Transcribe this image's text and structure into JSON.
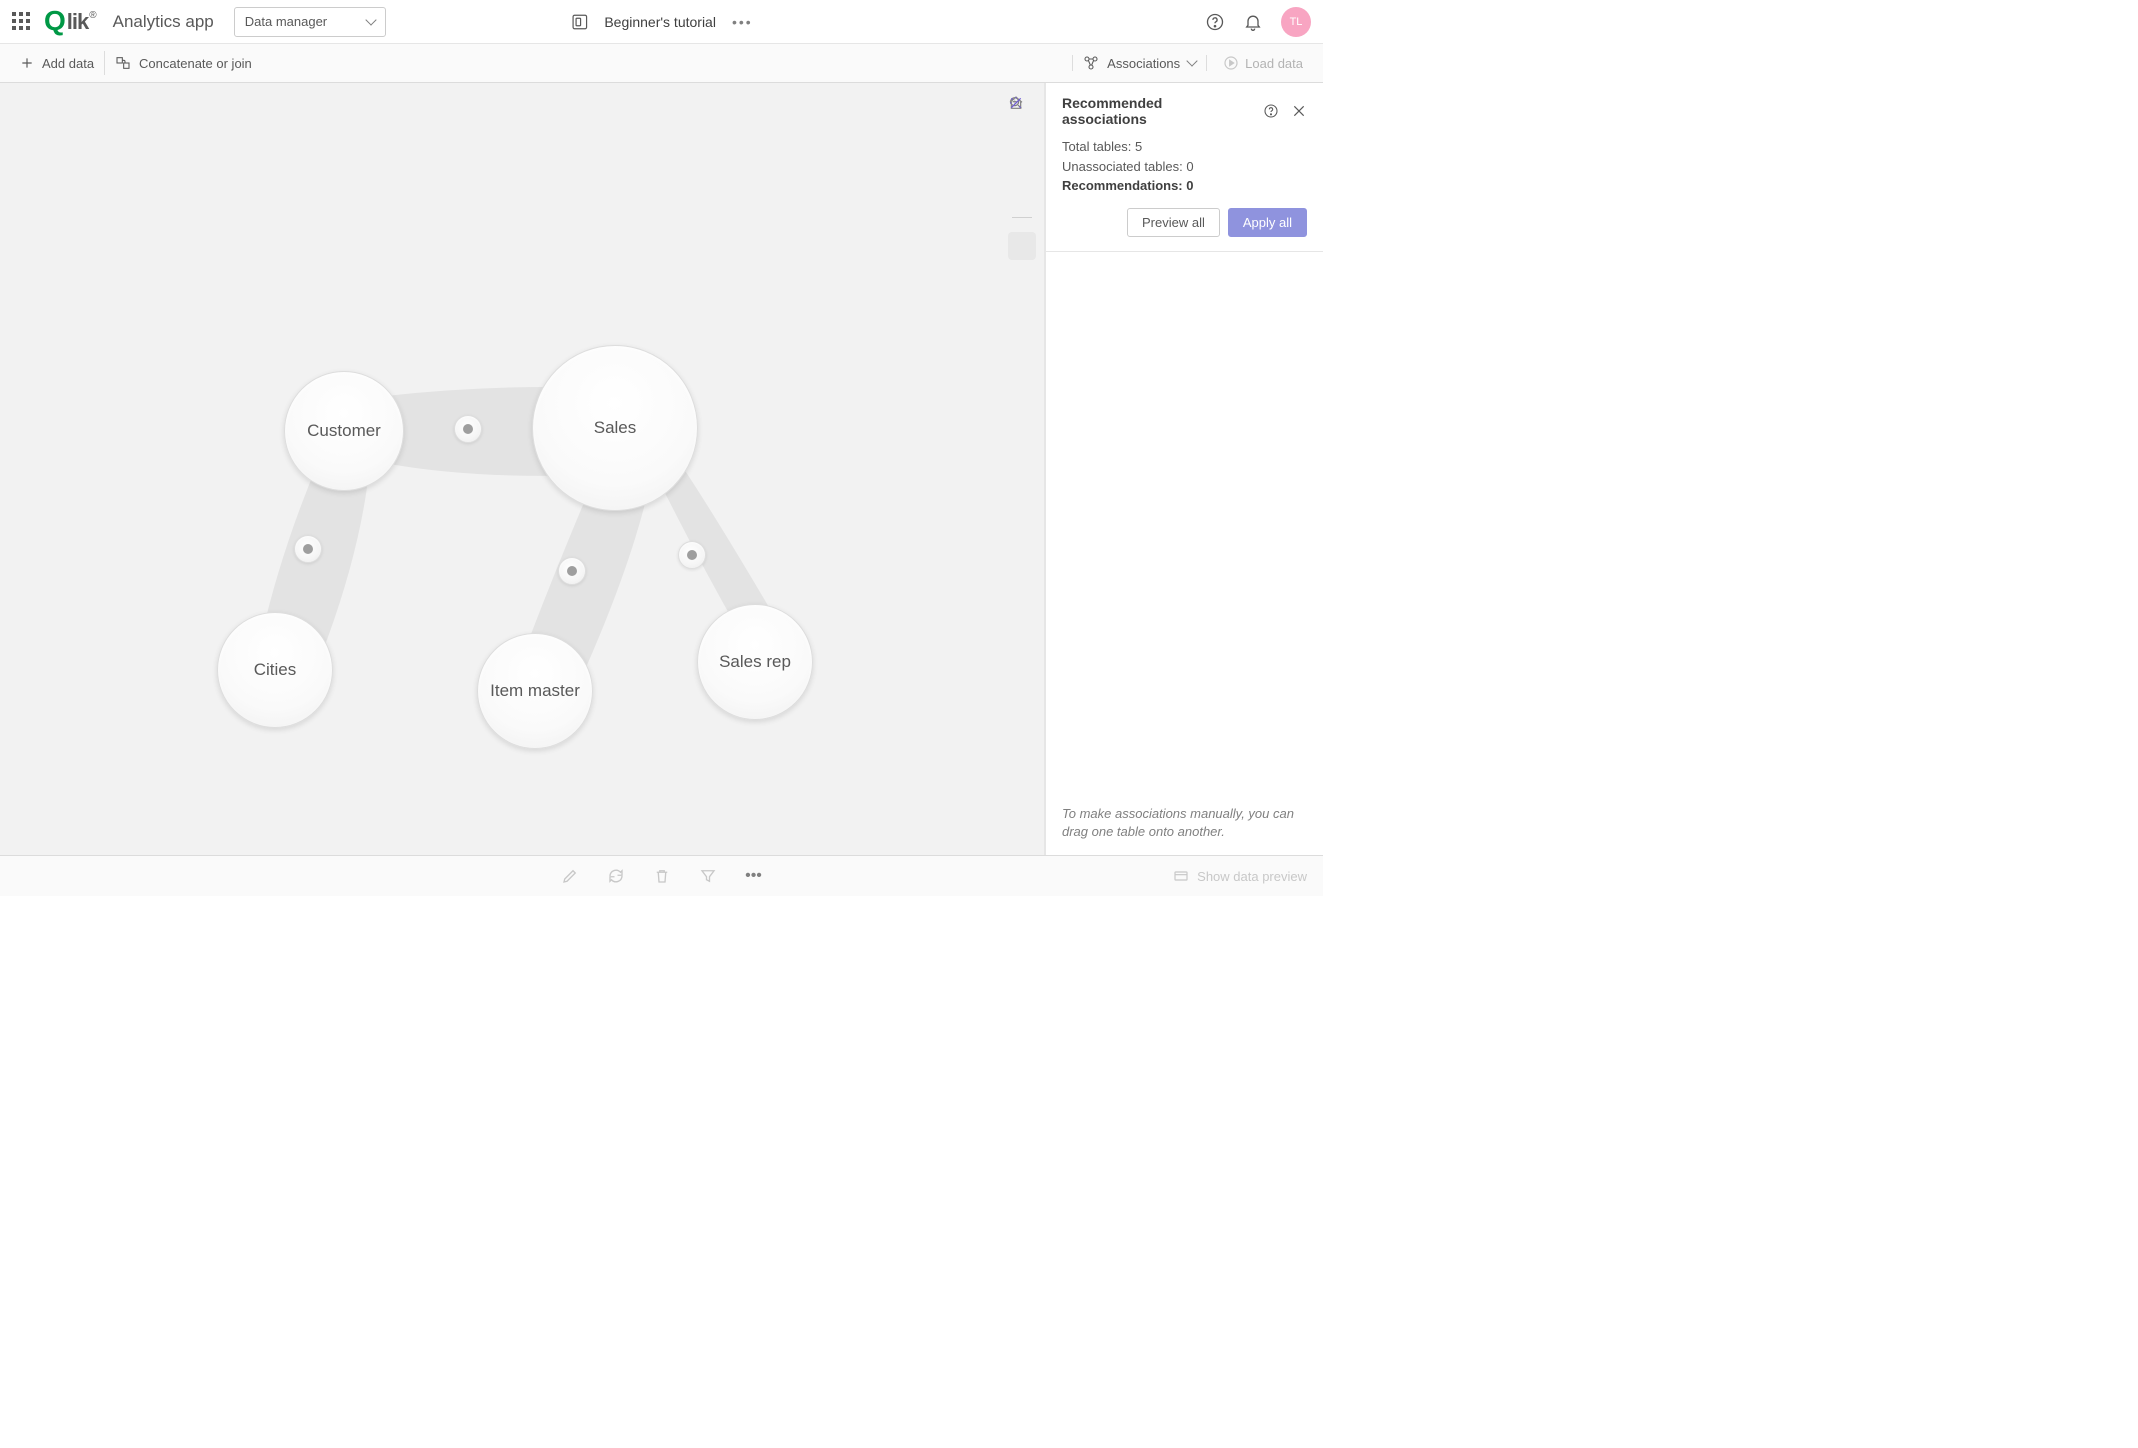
{
  "header": {
    "app_name": "Analytics app",
    "dropdown_label": "Data manager",
    "tutorial_label": "Beginner's tutorial",
    "avatar_initials": "TL"
  },
  "toolbar": {
    "add_data": "Add data",
    "concat": "Concatenate or join",
    "associations": "Associations",
    "load_data": "Load data"
  },
  "bubbles": {
    "customer": "Customer",
    "sales": "Sales",
    "cities": "Cities",
    "item_master": "Item master",
    "sales_rep": "Sales rep"
  },
  "panel": {
    "title": "Recommended associations",
    "total_label": "Total tables:",
    "total_val": "5",
    "unassoc_label": "Unassociated tables:",
    "unassoc_val": "0",
    "rec_label": "Recommendations:",
    "rec_val": "0",
    "preview": "Preview all",
    "apply": "Apply all",
    "foot": "To make associations manually, you can drag one table onto another."
  },
  "bottom": {
    "show_preview": "Show data preview"
  }
}
